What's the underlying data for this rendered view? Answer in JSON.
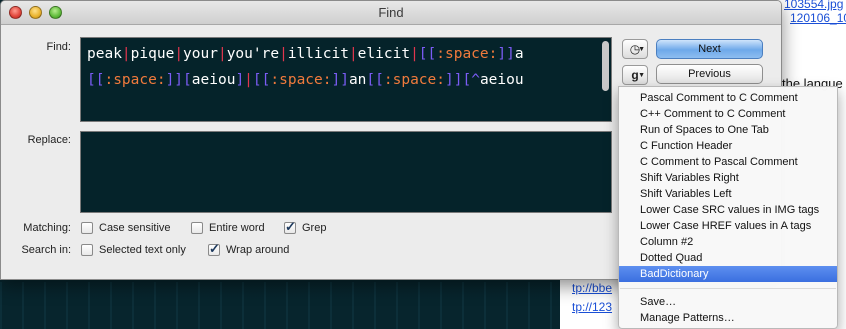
{
  "window": {
    "title": "Find"
  },
  "labels": {
    "find": "Find:",
    "replace": "Replace:",
    "matching": "Matching:",
    "search_in": "Search in:"
  },
  "find_field": {
    "line1": [
      {
        "t": "peak",
        "c": "#ffffff"
      },
      {
        "t": "|",
        "c": "#e0364e"
      },
      {
        "t": "pique",
        "c": "#ffffff"
      },
      {
        "t": "|",
        "c": "#e0364e"
      },
      {
        "t": "your",
        "c": "#ffffff"
      },
      {
        "t": "|",
        "c": "#e0364e"
      },
      {
        "t": "you're",
        "c": "#ffffff"
      },
      {
        "t": "|",
        "c": "#e0364e"
      },
      {
        "t": "illicit",
        "c": "#ffffff"
      },
      {
        "t": "|",
        "c": "#e0364e"
      },
      {
        "t": "elicit",
        "c": "#ffffff"
      },
      {
        "t": "|",
        "c": "#e0364e"
      },
      {
        "t": "[[",
        "c": "#7b5cf5"
      },
      {
        "t": ":space:",
        "c": "#f07a3c"
      },
      {
        "t": "]]",
        "c": "#7b5cf5"
      },
      {
        "t": "a",
        "c": "#ffffff"
      }
    ],
    "line2": [
      {
        "t": "[[",
        "c": "#7b5cf5"
      },
      {
        "t": ":space:",
        "c": "#f07a3c"
      },
      {
        "t": "]]",
        "c": "#7b5cf5"
      },
      {
        "t": "[",
        "c": "#7b5cf5"
      },
      {
        "t": "aeiou",
        "c": "#ffffff"
      },
      {
        "t": "]",
        "c": "#7b5cf5"
      },
      {
        "t": "|",
        "c": "#e0364e"
      },
      {
        "t": "[[",
        "c": "#7b5cf5"
      },
      {
        "t": ":space:",
        "c": "#f07a3c"
      },
      {
        "t": "]]",
        "c": "#7b5cf5"
      },
      {
        "t": "an",
        "c": "#ffffff"
      },
      {
        "t": "[[",
        "c": "#7b5cf5"
      },
      {
        "t": ":space:",
        "c": "#f07a3c"
      },
      {
        "t": "]]",
        "c": "#7b5cf5"
      },
      {
        "t": "[^",
        "c": "#7b5cf5"
      },
      {
        "t": "aeiou",
        "c": "#ffffff"
      }
    ]
  },
  "replace_field": {
    "value": ""
  },
  "buttons": {
    "next": "Next",
    "previous": "Previous",
    "history_icon": "clock-icon",
    "grep_icon": "g"
  },
  "matching": {
    "case_sensitive": {
      "label": "Case sensitive",
      "checked": false
    },
    "entire_word": {
      "label": "Entire word",
      "checked": false
    },
    "grep": {
      "label": "Grep",
      "checked": true
    }
  },
  "search_in": {
    "selected_text_only": {
      "label": "Selected text only",
      "checked": false
    },
    "wrap_around": {
      "label": "Wrap around",
      "checked": true
    }
  },
  "grep_menu": {
    "items": [
      "Pascal Comment to C Comment",
      "C++ Comment to C Comment",
      "Run of Spaces to One Tab",
      "C Function Header",
      "C Comment to Pascal Comment",
      "Shift Variables Right",
      "Shift Variables Left",
      "Lower Case SRC values in IMG tags",
      "Lower Case HREF values in A tags",
      "Column #2",
      "Dotted Quad",
      "BadDictionary"
    ],
    "selected": "BadDictionary",
    "footer": [
      "Save…",
      "Manage Patterns…"
    ]
  },
  "background": {
    "links": [
      "103554.jpg",
      "120106_10",
      "tp://bbe",
      "tp://123"
    ],
    "text": [
      "the langue"
    ]
  }
}
